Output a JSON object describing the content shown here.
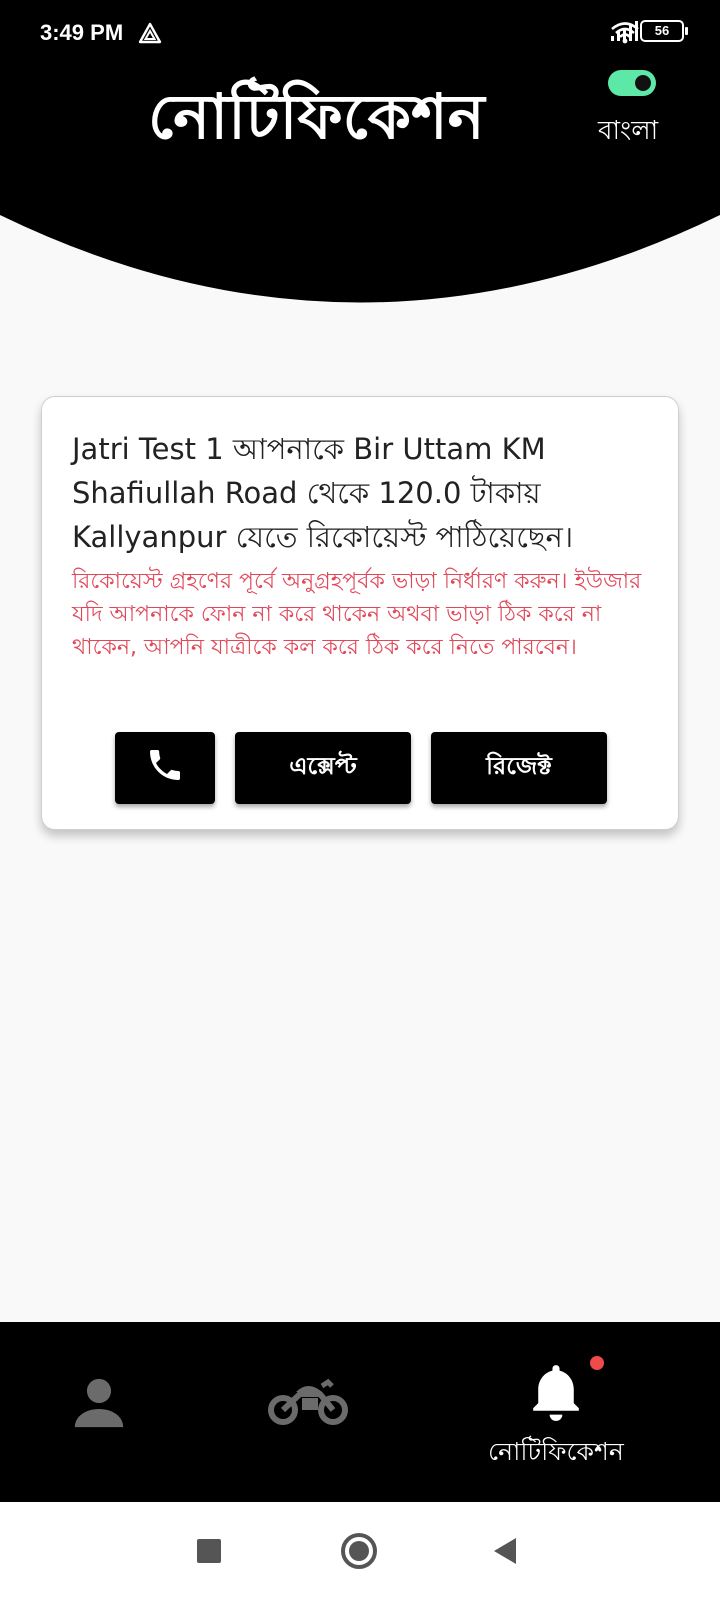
{
  "status_bar": {
    "time": "3:49 PM",
    "battery": "56"
  },
  "header": {
    "title": "নোটিফিকেশন",
    "language_toggle_on": true,
    "language_label": "বাংলা"
  },
  "request_card": {
    "message": "Jatri Test 1 আপনাকে Bir Uttam KM Shafiullah Road থেকে 120.0 টাকায় Kallyanpur যেতে  রিকোয়েস্ট পাঠিয়েছেন।",
    "warning": "রিকোয়েস্ট গ্রহণের পূর্বে অনুগ্রহপূর্বক ভাড়া নির্ধারণ করুন। ইউজার যদি আপনাকে ফোন না করে থাকেন অথবা ভাড়া ঠিক করে না থাকেন, আপনি যাত্রীকে কল করে ঠিক করে নিতে পারবেন।",
    "accept_label": "এক্সেপ্ট",
    "reject_label": "রিজেক্ট"
  },
  "bottom_nav": {
    "items": [
      {
        "icon": "person-icon",
        "label": ""
      },
      {
        "icon": "motorbike-icon",
        "label": ""
      },
      {
        "icon": "bell-icon",
        "label": "নোটিফিকেশন",
        "active": true
      }
    ]
  },
  "colors": {
    "header_bg": "#000000",
    "page_bg": "#f9f9f9",
    "warning_text": "#e0485a",
    "toggle_on": "#5de8a8",
    "notification_dot": "#f04a4a",
    "inactive_nav_icon": "#6b6b6b"
  }
}
